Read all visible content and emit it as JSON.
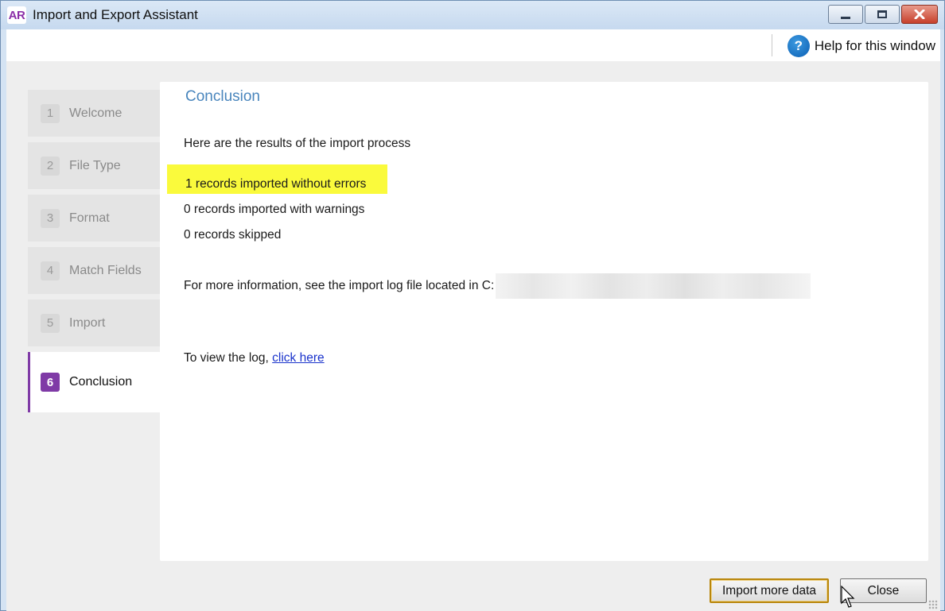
{
  "window": {
    "logo": "AR",
    "title": "Import and Export Assistant"
  },
  "help": {
    "label": "Help for this window",
    "icon": "question-icon",
    "icon_glyph": "?"
  },
  "steps": [
    {
      "num": "1",
      "label": "Welcome"
    },
    {
      "num": "2",
      "label": "File Type"
    },
    {
      "num": "3",
      "label": "Format"
    },
    {
      "num": "4",
      "label": "Match Fields"
    },
    {
      "num": "5",
      "label": "Import"
    },
    {
      "num": "6",
      "label": "Conclusion"
    }
  ],
  "active_step": "6",
  "content": {
    "title": "Conclusion",
    "intro": "Here are the results of the import process",
    "imported_ok": "1 records imported without errors",
    "imported_warn": "0 records imported with warnings",
    "skipped": "0 records skipped",
    "log_info": "For more information, see the import log file located in C:",
    "view_log_prefix": "To view the log,",
    "view_log_link": "click here"
  },
  "buttons": {
    "import_more": "Import more data",
    "close": "Close"
  },
  "colors": {
    "accent": "#7f3aa6",
    "title_blue": "#4a86bd",
    "highlight": "#fafa3c",
    "link": "#1a33cc"
  }
}
